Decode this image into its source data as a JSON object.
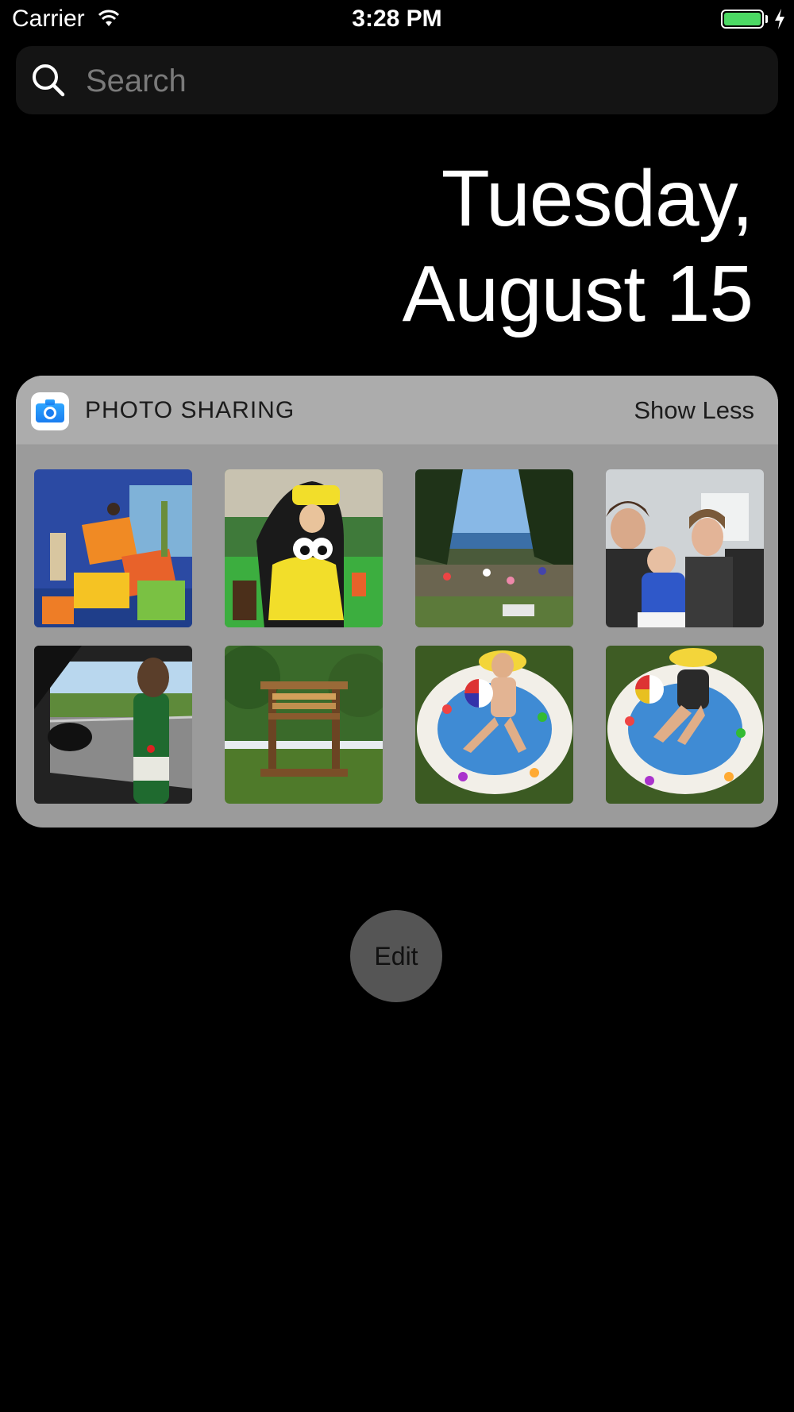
{
  "status_bar": {
    "carrier": "Carrier",
    "time": "3:28 PM",
    "battery_color": "#4cd964"
  },
  "search": {
    "placeholder": "Search"
  },
  "date": {
    "line1": "Tuesday,",
    "line2": "August 15"
  },
  "widget": {
    "app_name": "PHOTO SHARING",
    "toggle_label": "Show Less",
    "app_icon": "camera-icon",
    "photos": [
      {
        "subject": "indoor-playground"
      },
      {
        "subject": "toddler-toy-car"
      },
      {
        "subject": "crowded-lake-beach"
      },
      {
        "subject": "car-selfie"
      },
      {
        "subject": "car-window-road"
      },
      {
        "subject": "wooden-treehouse"
      },
      {
        "subject": "pool-with-beach-ball"
      },
      {
        "subject": "pool-lying"
      }
    ]
  },
  "edit": {
    "label": "Edit"
  }
}
